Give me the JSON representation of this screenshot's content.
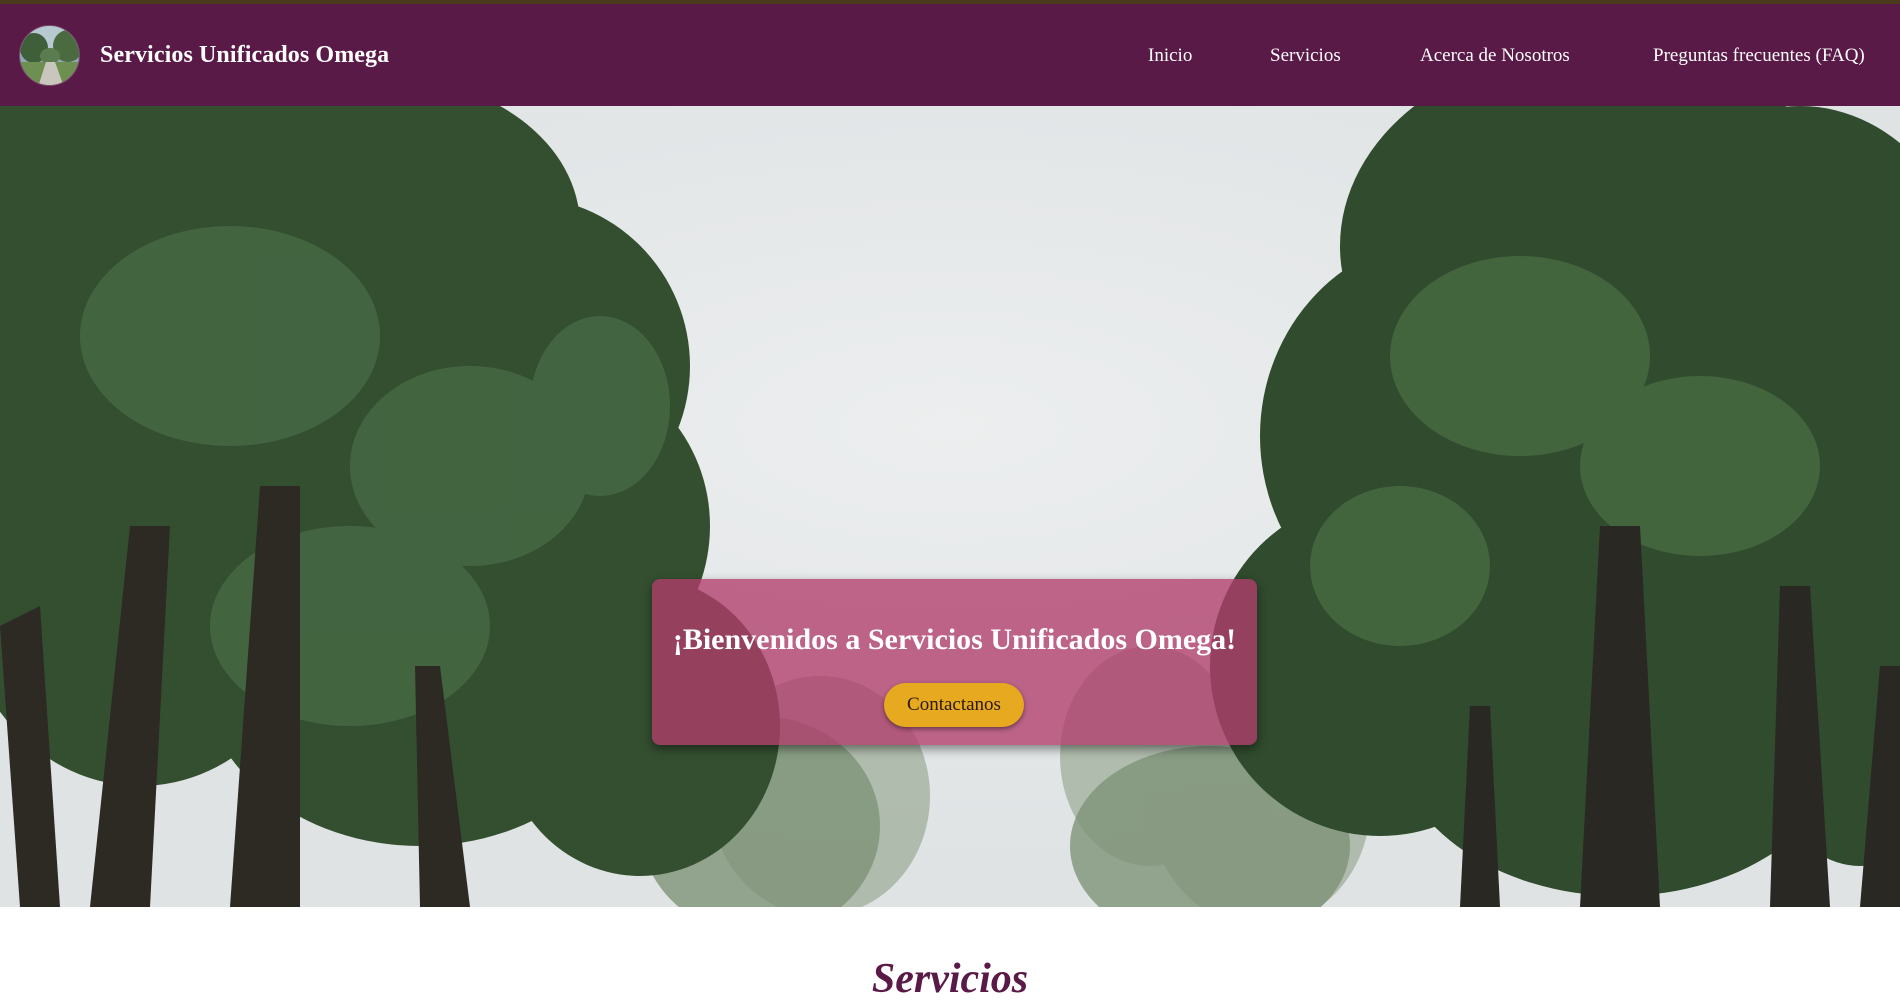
{
  "header": {
    "brand": "Servicios Unificados Omega",
    "nav": [
      {
        "label": "Inicio"
      },
      {
        "label": "Servicios"
      },
      {
        "label": "Acerca de Nosotros"
      },
      {
        "label": "Preguntas frecuentes (FAQ)"
      }
    ]
  },
  "hero": {
    "title": "¡Bienvenidos a Servicios Unificados Omega!",
    "button": "Contactanos",
    "slides": [
      "1",
      "2",
      "3"
    ],
    "active_slide": 1
  },
  "section": {
    "title": "Servicios"
  },
  "colors": {
    "nav_bg": "#5a1a47",
    "accent": "#e7a91f",
    "welcome_bg": "#b13e6c",
    "section_title": "#5a1a47"
  }
}
